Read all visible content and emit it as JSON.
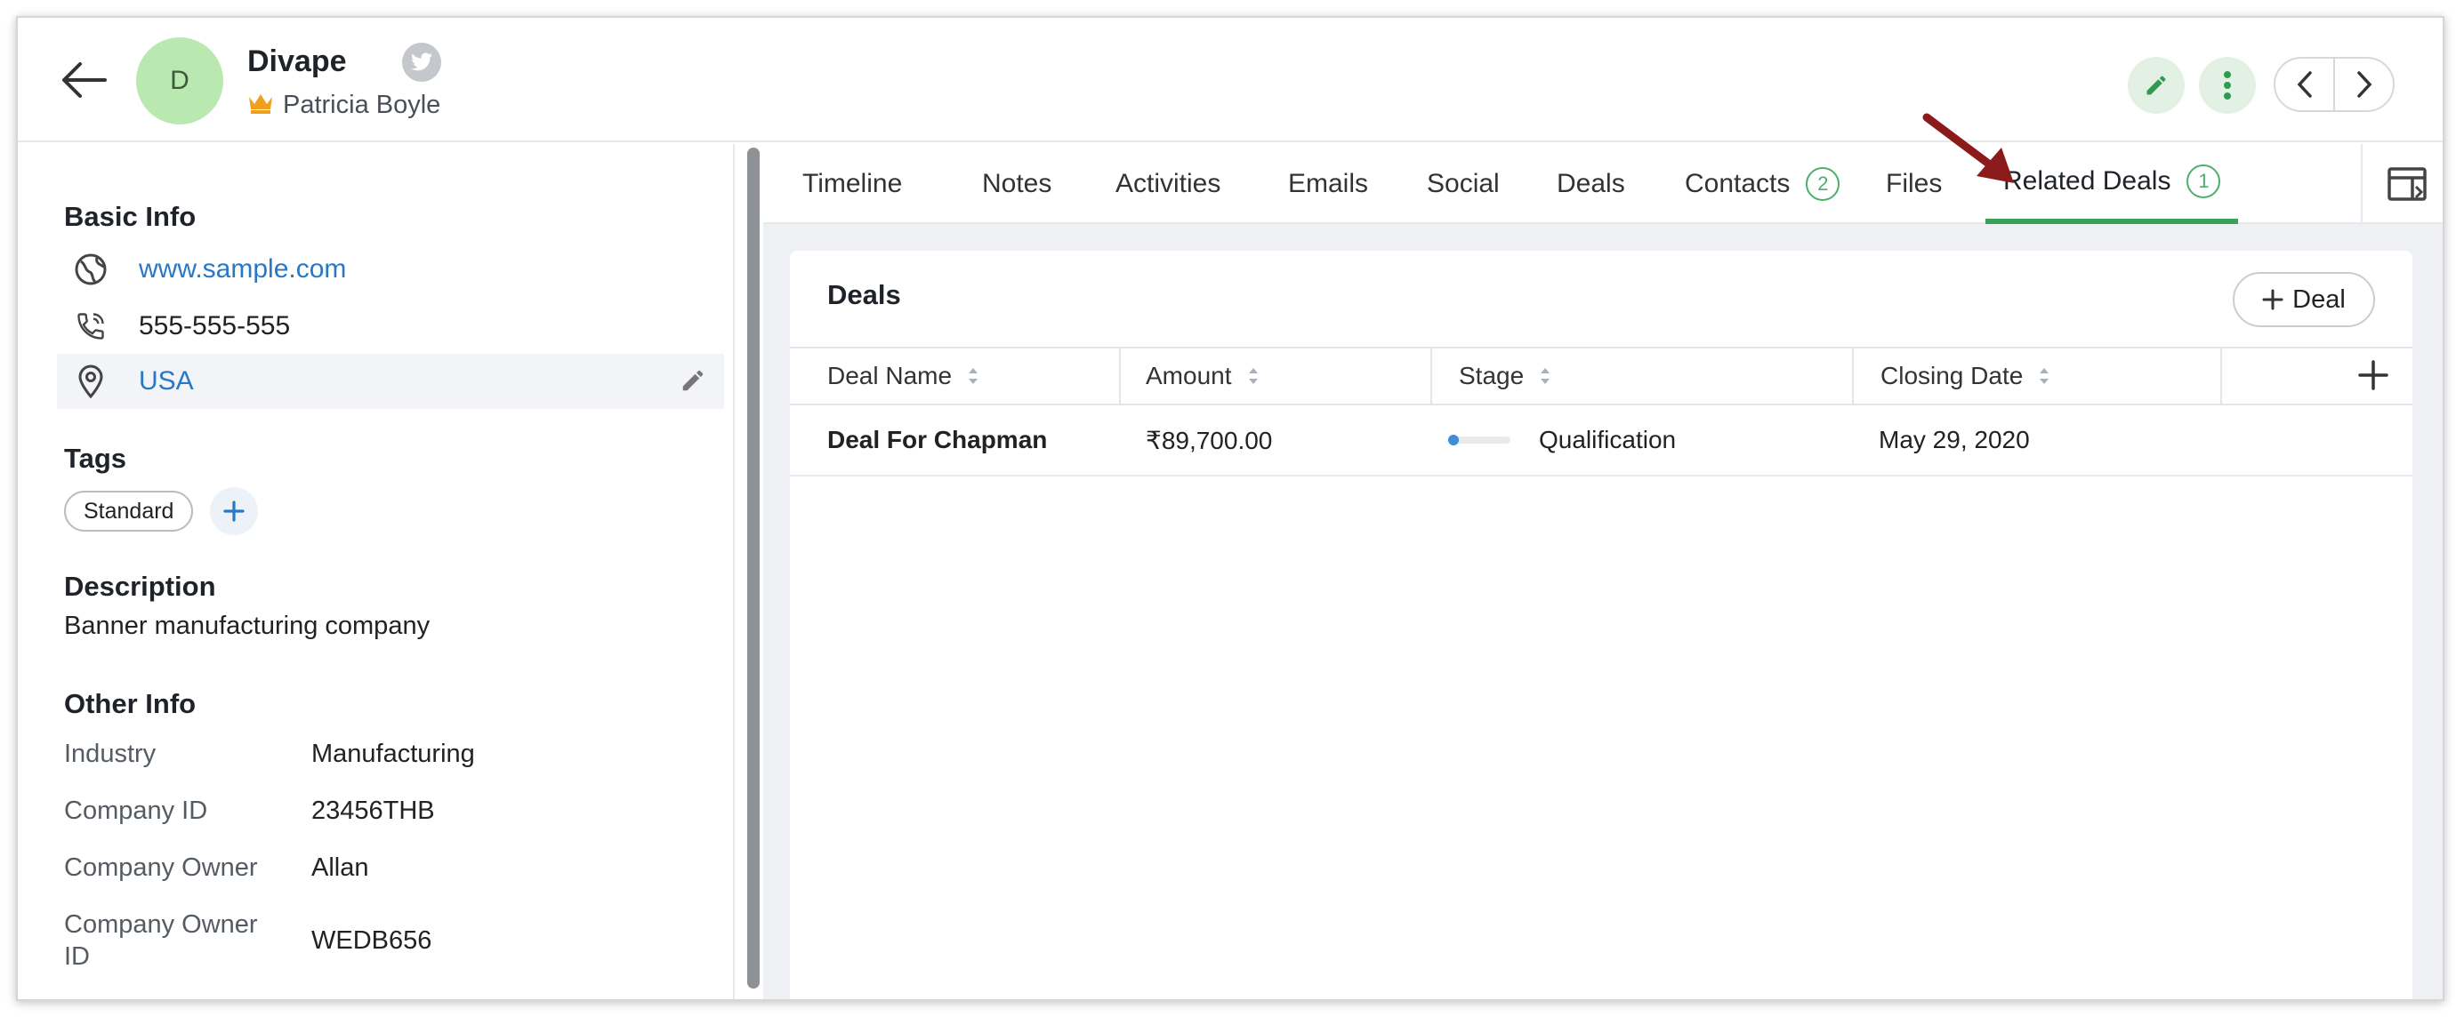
{
  "header": {
    "avatar_initial": "D",
    "company_name": "Divape",
    "owner_name": "Patricia Boyle"
  },
  "basic_info": {
    "title": "Basic Info",
    "website": "www.sample.com",
    "phone": "555-555-555",
    "country": "USA"
  },
  "tags": {
    "title": "Tags",
    "items": [
      "Standard"
    ]
  },
  "description": {
    "title": "Description",
    "text": "Banner manufacturing company"
  },
  "other_info": {
    "title": "Other Info",
    "fields": [
      {
        "label": "Industry",
        "value": "Manufacturing"
      },
      {
        "label": "Company ID",
        "value": "23456THB"
      },
      {
        "label": "Company Owner",
        "value": "Allan"
      },
      {
        "label": "Company Owner ID",
        "value": "WEDB656"
      }
    ]
  },
  "tabs": [
    {
      "label": "Timeline"
    },
    {
      "label": "Notes"
    },
    {
      "label": "Activities"
    },
    {
      "label": "Emails"
    },
    {
      "label": "Social"
    },
    {
      "label": "Deals"
    },
    {
      "label": "Contacts",
      "badge": "2"
    },
    {
      "label": "Files"
    },
    {
      "label": "Related Deals",
      "badge": "1"
    }
  ],
  "active_tab": "Related Deals",
  "deals_card": {
    "title": "Deals",
    "add_button_label": "Deal",
    "columns": [
      "Deal Name",
      "Amount",
      "Stage",
      "Closing Date"
    ],
    "rows": [
      {
        "deal_name": "Deal For Chapman",
        "amount": "₹89,700.00",
        "stage": "Qualification",
        "closing_date": "May 29, 2020"
      }
    ]
  },
  "colors": {
    "accent_green": "#3aa05a",
    "link_blue": "#2878c8",
    "avatar_bg": "#b9e8b0",
    "arrow_red": "#8b1a1a"
  }
}
